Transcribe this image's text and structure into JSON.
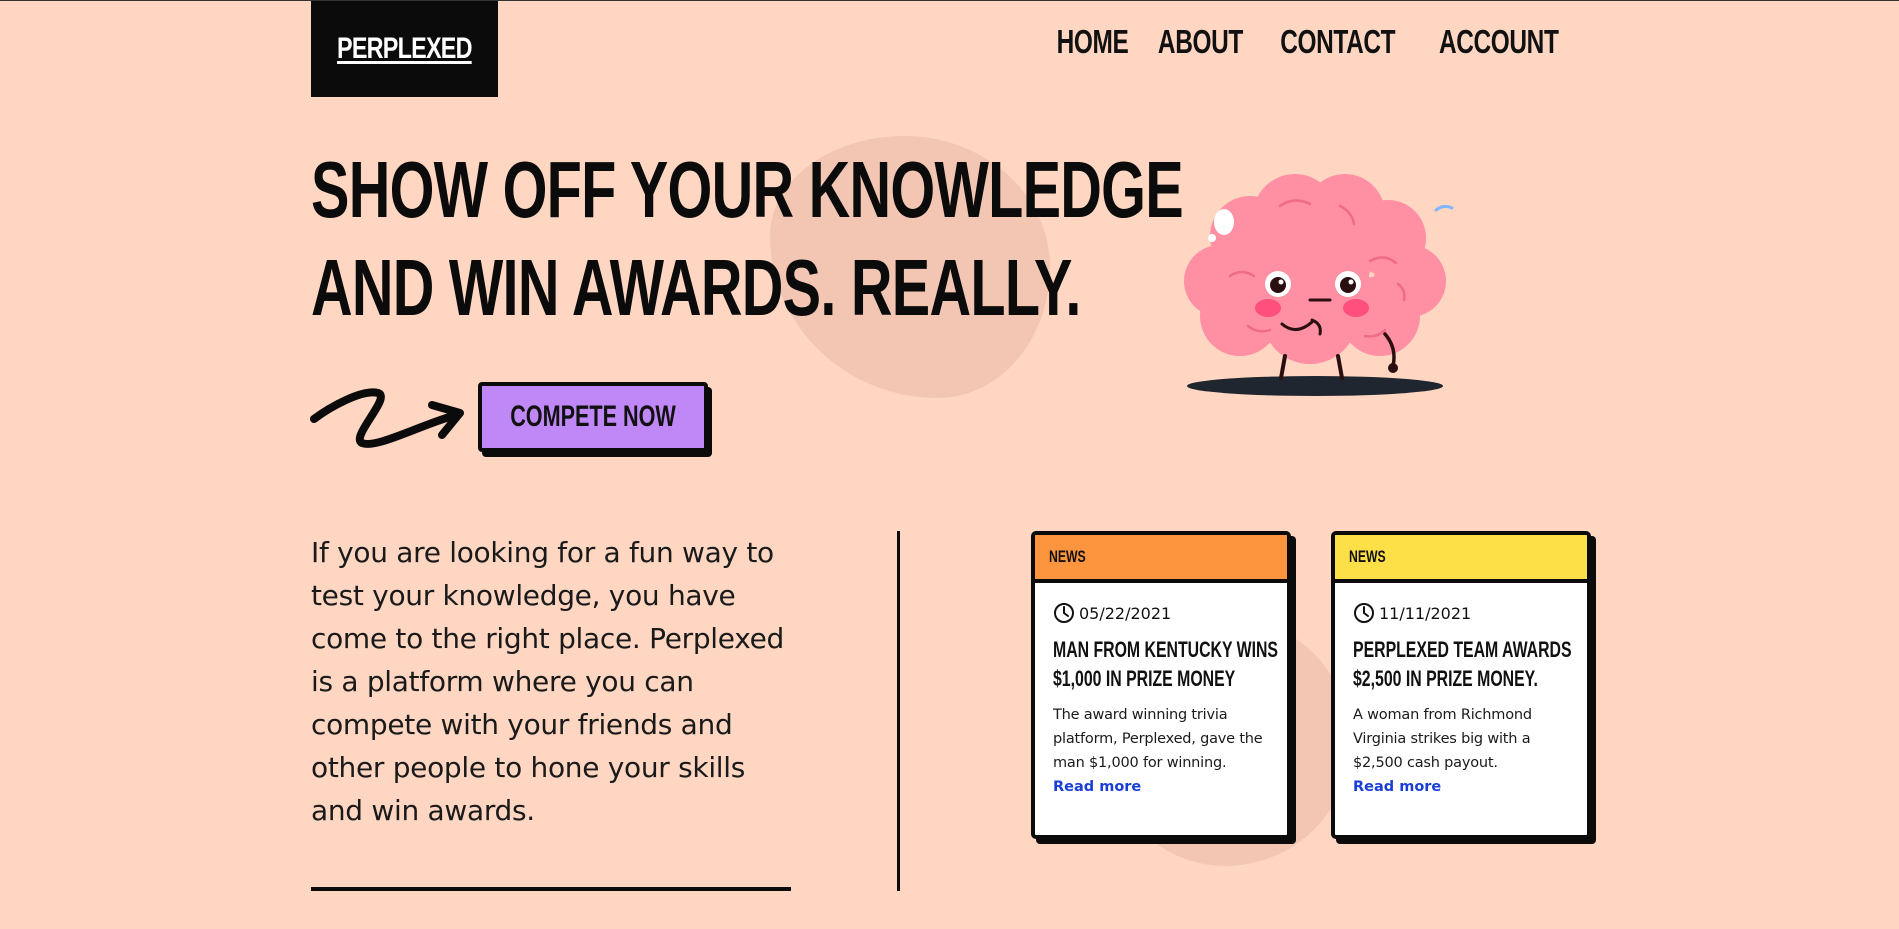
{
  "brand": {
    "logo_text": "PERPLEXED"
  },
  "nav": {
    "items": [
      "HOME",
      "ABOUT",
      "CONTACT",
      "ACCOUNT"
    ]
  },
  "hero": {
    "headline_line1": "SHOW OFF YOUR KNOWLEDGE",
    "headline_line2": "AND WIN AWARDS. REALLY.",
    "cta_label": "COMPETE NOW",
    "cta_color": "#c088f7",
    "mascot": "pink-brain-mascot"
  },
  "intro": {
    "text": "If you are looking for a fun way to test your knowledge, you have come to the right place. Perplexed is a platform where you can compete with your friends and other people to hone your skills and win awards."
  },
  "news": [
    {
      "tag": "NEWS",
      "tag_color": "#fd953f",
      "date": "05/22/2021",
      "title_line1": "MAN FROM KENTUCKY WINS",
      "title_line2": "$1,000 IN PRIZE MONEY",
      "excerpt": "The award winning trivia platform, Perplexed, gave the man $1,000 for winning.",
      "link": "Read more"
    },
    {
      "tag": "NEWS",
      "tag_color": "#fde047",
      "date": "11/11/2021",
      "title_line1": "PERPLEXED TEAM AWARDS",
      "title_line2": "$2,500 IN PRIZE MONEY.",
      "excerpt": "A woman from Richmond Virginia strikes big with a $2,500 cash payout.",
      "link": "Read more"
    }
  ],
  "colors": {
    "background": "#ffd6c2",
    "ink": "#0b0b0b",
    "link": "#1a3fd6"
  }
}
